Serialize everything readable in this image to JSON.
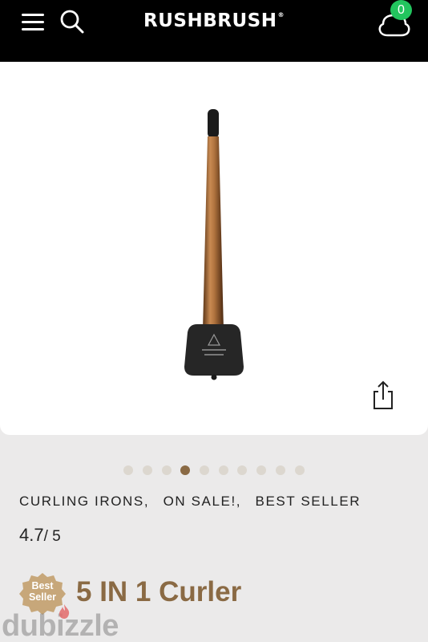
{
  "header": {
    "brand": "RUSHBRUSH",
    "brand_mark": "®",
    "menu_icon": "hamburger-menu-icon",
    "search_icon": "search-icon",
    "cart_icon": "cart-icon",
    "cart_count": "0",
    "cart_badge_color": "#22c55e"
  },
  "gallery": {
    "image_alt": "Curling iron on stand",
    "share_icon": "share-icon",
    "total_slides": 10,
    "active_slide": 4
  },
  "product": {
    "categories": [
      "CURLING IRONS,",
      "ON SALE!,",
      "BEST SELLER"
    ],
    "rating_value": "4.7",
    "rating_out_of": "/ 5",
    "badge_line1": "Best",
    "badge_line2": "Seller",
    "title": "5 IN 1 Curler",
    "accent_color": "#8a6a44"
  },
  "watermark": {
    "text": "dubizzle"
  }
}
